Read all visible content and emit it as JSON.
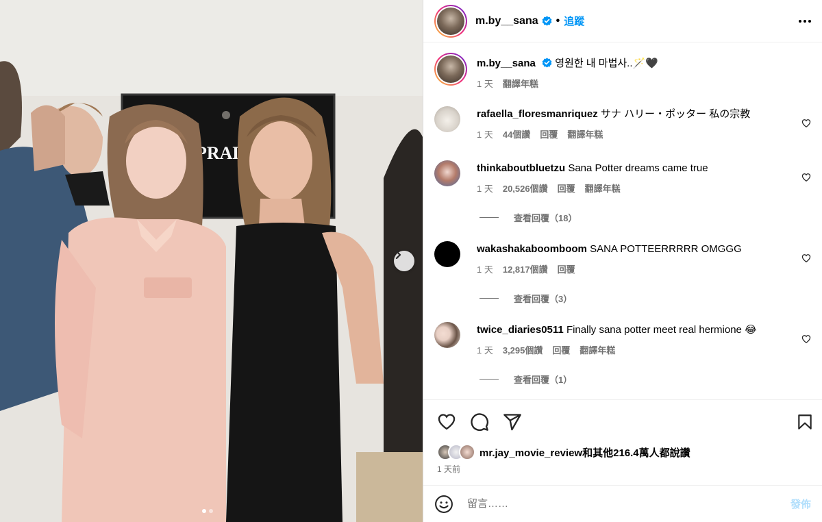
{
  "colors": {
    "accent": "#0095f6",
    "muted": "#737373",
    "disabled_post": "#b2dffc",
    "verified": "#0095f6"
  },
  "photo": {
    "sign_text": "PRAD",
    "next_icon": "chevron-right-icon",
    "carousel_dots": 2,
    "active_dot": 1
  },
  "header": {
    "username": "m.by__sana",
    "verified_icon": "verified-badge-icon",
    "separator": "•",
    "follow_label": "追蹤",
    "more_icon": "more-options-icon"
  },
  "caption": {
    "username": "m.by__sana",
    "text": "영원한 내 마법사..🪄🖤",
    "time": "1 天",
    "translate": "翻譯年糕"
  },
  "comments": [
    {
      "username": "rafaella_floresmanriquez",
      "text": "サナ ハリー・ポッター 私の宗教",
      "time": "1 天",
      "likes": "44個讚",
      "reply": "回覆",
      "translate": "翻譯年糕"
    },
    {
      "username": "thinkaboutbluetzu",
      "text": "Sana Potter dreams came true",
      "time": "1 天",
      "likes": "20,526個讚",
      "reply": "回覆",
      "translate": "翻譯年糕",
      "view_replies": "查看回覆（18）"
    },
    {
      "username": "wakashakaboomboom",
      "text": "SANA POTTEERRRRR OMGGG",
      "time": "1 天",
      "likes": "12,817個讚",
      "reply": "回覆",
      "view_replies": "查看回覆（3）"
    },
    {
      "username": "twice_diaries0511",
      "text": "Finally sana potter meet real hermione 😂",
      "time": "1 天",
      "likes": "3,295個讚",
      "reply": "回覆",
      "translate": "翻譯年糕",
      "view_replies": "查看回覆（1）"
    }
  ],
  "actions": {
    "like_icon": "heart-icon",
    "comment_icon": "comment-icon",
    "share_icon": "share-icon",
    "save_icon": "bookmark-icon"
  },
  "likes_line": {
    "user": "mr.jay_movie_review",
    "rest": "和其他216.4萬人都說讚"
  },
  "time_ago": "1 天前",
  "add_comment": {
    "emoji_icon": "emoji-icon",
    "placeholder": "留言……",
    "post_label": "發佈"
  }
}
